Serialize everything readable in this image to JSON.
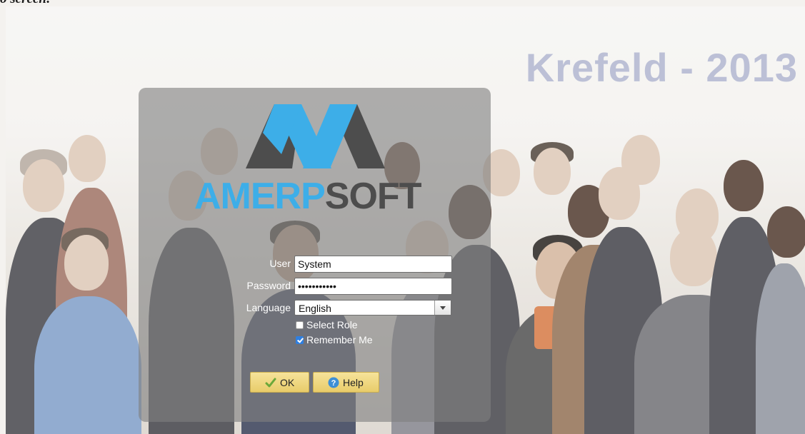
{
  "page": {
    "caption": "o screen:"
  },
  "background": {
    "title": "Krefeld - 2013"
  },
  "logo": {
    "text_part1": "AMERP",
    "text_part2": "SOFT",
    "color_blue": "#3daee8",
    "color_dark": "#4d4d4d"
  },
  "form": {
    "user_label": "User",
    "user_value": "System",
    "password_label": "Password",
    "password_value": "•••••••••••",
    "language_label": "Language",
    "language_value": "English",
    "select_role_label": "Select Role",
    "select_role_checked": false,
    "remember_me_label": "Remember Me",
    "remember_me_checked": true
  },
  "buttons": {
    "ok_label": "OK",
    "help_label": "Help",
    "ok_icon": "checkmark-icon",
    "help_icon": "question-icon"
  }
}
